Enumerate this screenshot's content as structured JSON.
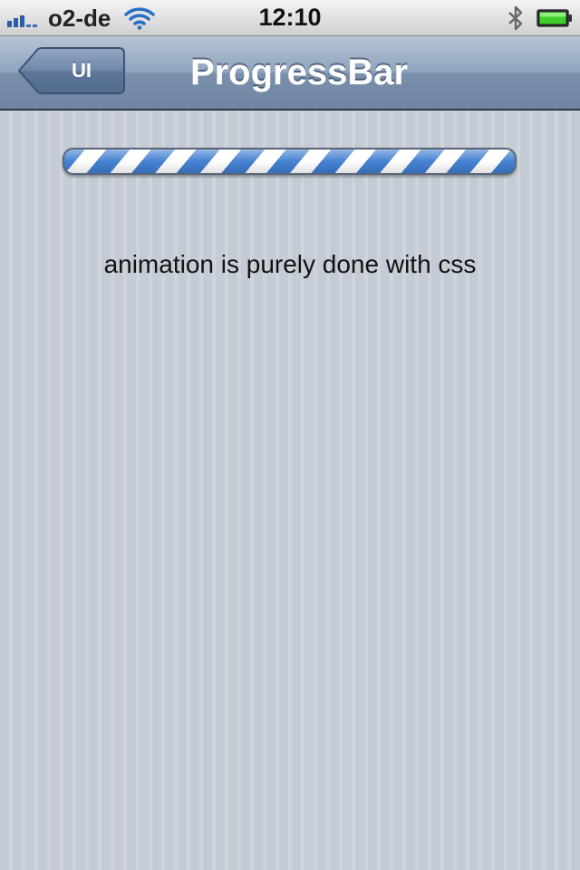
{
  "status_bar": {
    "carrier": "o2-de",
    "time": "12:10",
    "signal_bars": 3,
    "battery_level": 1.0,
    "icons": [
      "signal-icon",
      "wifi-icon",
      "bluetooth-icon",
      "battery-icon"
    ]
  },
  "nav": {
    "back_label": "UI",
    "title": "ProgressBar"
  },
  "progress": {
    "value": 1.0,
    "colors": {
      "stripe_blue": "#3d7cd0",
      "stripe_white": "#ffffff"
    }
  },
  "content": {
    "caption": "animation is purely done with css"
  }
}
